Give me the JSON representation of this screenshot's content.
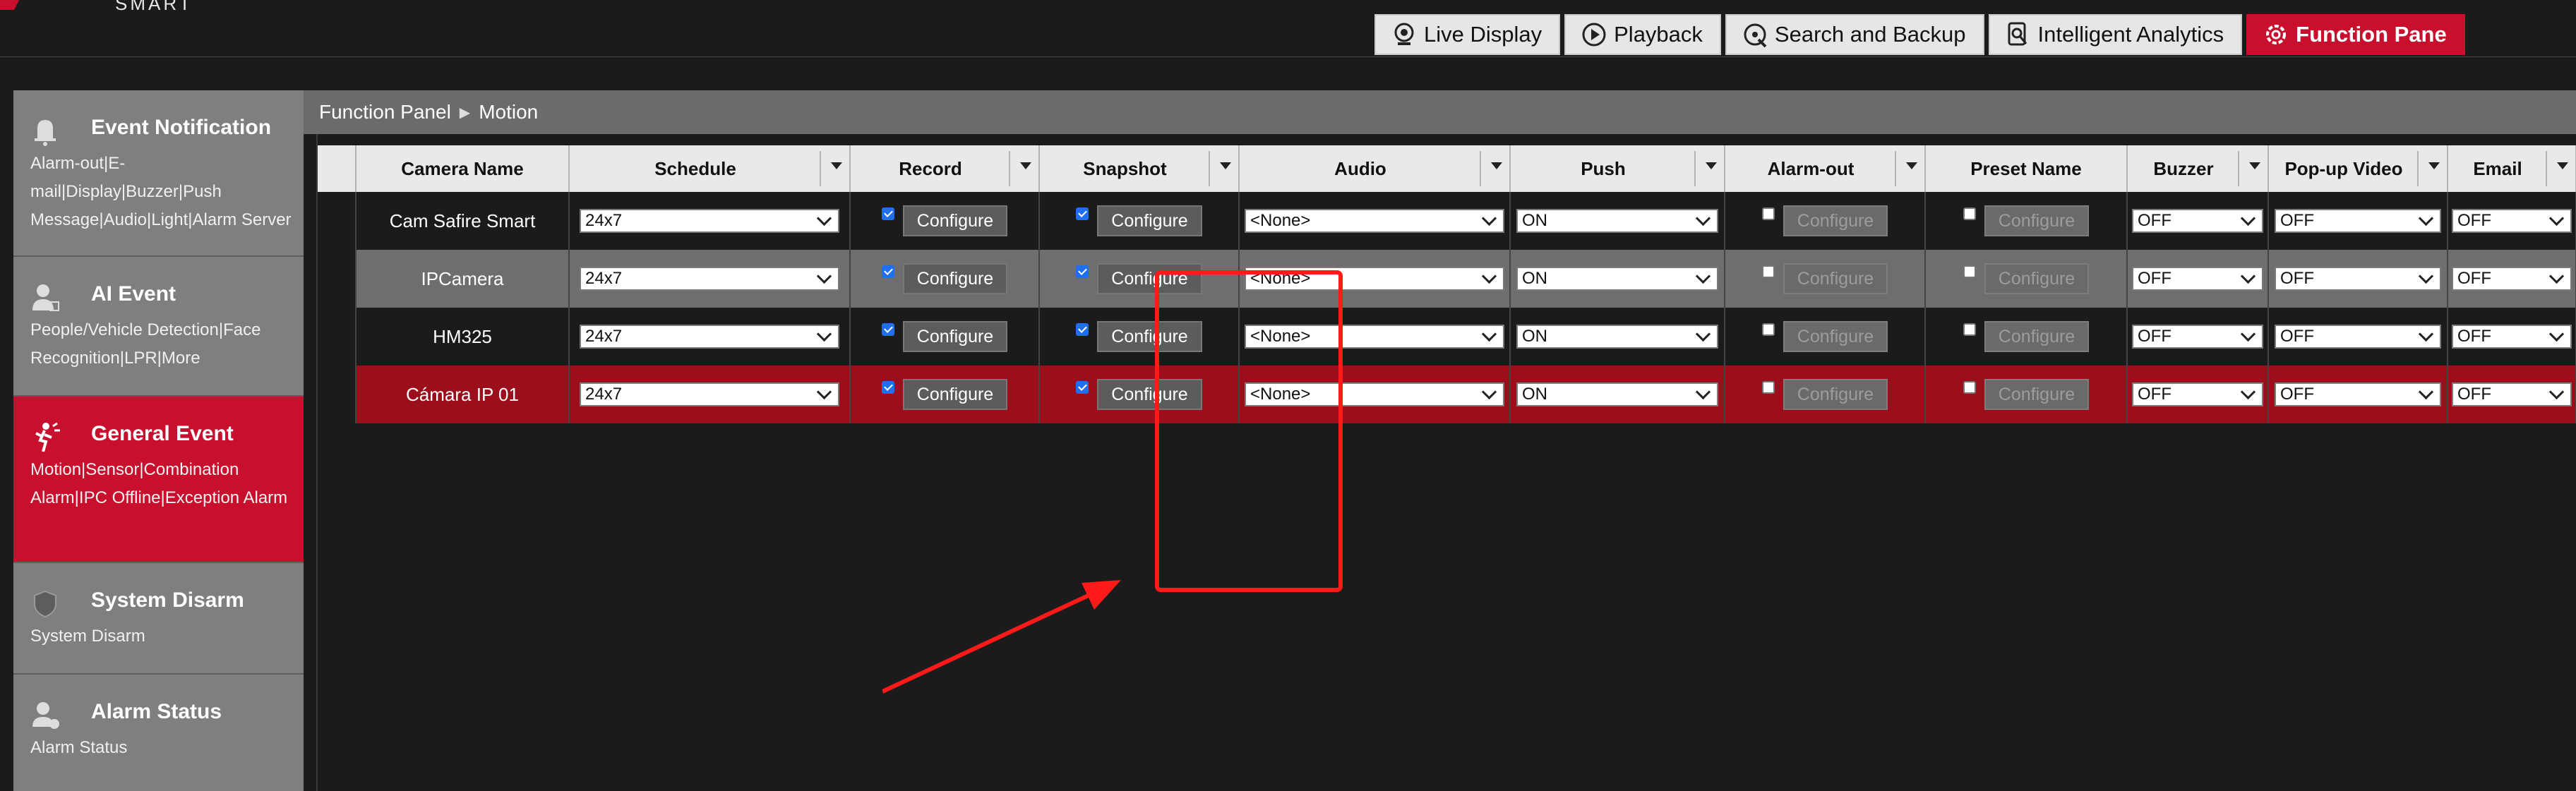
{
  "header": {
    "logo_text": "SMART",
    "tabs": [
      {
        "label": "Live Display",
        "icon": "camera-icon",
        "active": false
      },
      {
        "label": "Playback",
        "icon": "play-icon",
        "active": false
      },
      {
        "label": "Search and Backup",
        "icon": "search-backup-icon",
        "active": false
      },
      {
        "label": "Intelligent Analytics",
        "icon": "analytics-icon",
        "active": false
      },
      {
        "label": "Function Pane",
        "icon": "gear-icon",
        "active": true
      }
    ]
  },
  "sidebar": {
    "items": [
      {
        "title": "Event Notification",
        "desc": "Alarm-out|E-mail|Display|Buzzer|Push Message|Audio|Light|Alarm Server",
        "icon": "bell-icon",
        "active": false
      },
      {
        "title": "AI Event",
        "desc": "People/Vehicle Detection|Face Recognition|LPR|More",
        "icon": "person-ai-icon",
        "active": false
      },
      {
        "title": "General Event",
        "desc": "Motion|Sensor|Combination Alarm|IPC Offline|Exception Alarm",
        "icon": "motion-icon",
        "active": true
      },
      {
        "title": "System Disarm",
        "desc": "System Disarm",
        "icon": "shield-icon",
        "active": false
      },
      {
        "title": "Alarm Status",
        "desc": "Alarm Status",
        "icon": "alarm-status-icon",
        "active": false
      }
    ]
  },
  "breadcrumb": {
    "root": "Function Panel",
    "current": "Motion"
  },
  "table": {
    "columns": [
      "Camera Name",
      "Schedule",
      "Record",
      "Snapshot",
      "Audio",
      "Push",
      "Alarm-out",
      "Preset Name",
      "Buzzer",
      "Pop-up Video",
      "Email"
    ],
    "configure_label": "Configure",
    "rows": [
      {
        "camera": "Cam Safire Smart",
        "schedule": "24x7",
        "record": true,
        "snapshot": true,
        "audio": "<None>",
        "push": "ON",
        "alarm_out": false,
        "preset": false,
        "buzzer": "OFF",
        "popup": "OFF",
        "email": "OFF",
        "style": "dark"
      },
      {
        "camera": "IPCamera",
        "schedule": "24x7",
        "record": true,
        "snapshot": true,
        "audio": "<None>",
        "push": "ON",
        "alarm_out": false,
        "preset": false,
        "buzzer": "OFF",
        "popup": "OFF",
        "email": "OFF",
        "style": "gray"
      },
      {
        "camera": "HM325",
        "schedule": "24x7",
        "record": true,
        "snapshot": true,
        "audio": "<None>",
        "push": "ON",
        "alarm_out": false,
        "preset": false,
        "buzzer": "OFF",
        "popup": "OFF",
        "email": "OFF",
        "style": "dark"
      },
      {
        "camera": "Cámara IP 01",
        "schedule": "24x7",
        "record": true,
        "snapshot": true,
        "audio": "<None>",
        "push": "ON",
        "alarm_out": false,
        "preset": false,
        "buzzer": "OFF",
        "popup": "OFF",
        "email": "OFF",
        "style": "red"
      }
    ]
  },
  "colors": {
    "accent": "#c8102e",
    "sidebar": "#7f7f7f",
    "background": "#1b1b1b",
    "selected_row": "#9a0f1b",
    "annotation": "#ff1a1a"
  }
}
